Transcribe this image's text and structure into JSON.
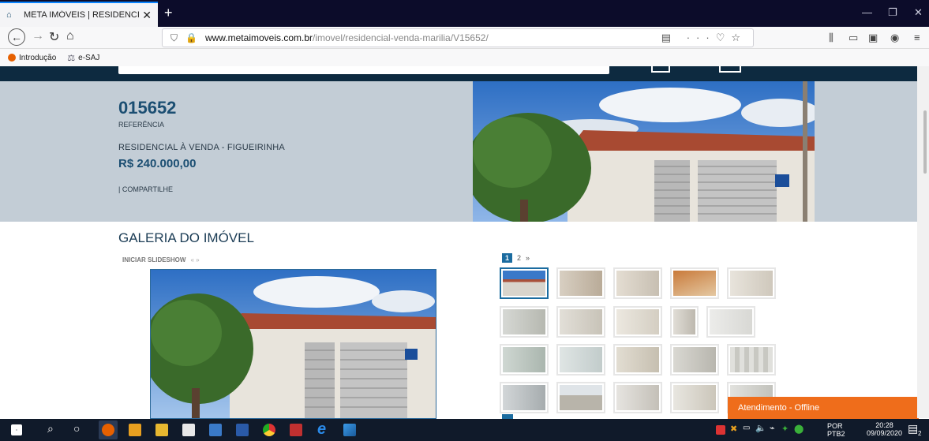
{
  "browser": {
    "tab_title": "META IMÓVEIS | RESIDENCIAL /",
    "tab_close": "✕",
    "new_tab": "+",
    "url_domain": "www.metaimoveis.com.br",
    "url_path": "/imovel/residencial-venda-marilia/V15652/",
    "bookmarks": [
      {
        "label": "Introdução"
      },
      {
        "label": "e-SAJ"
      }
    ]
  },
  "listing": {
    "reference": "015652",
    "reference_label": "REFERÊNCIA",
    "subtitle": "RESIDENCIAL À VENDA - FIGUEIRINHA",
    "price": "R$ 240.000,00",
    "share": "| COMPARTILHE"
  },
  "gallery": {
    "title": "GALERIA DO IMÓVEL",
    "slideshow_label": "INICIAR SLIDESHOW",
    "slideshow_arrows": "« »",
    "pages": [
      "1",
      "2"
    ],
    "next": "»"
  },
  "chat": {
    "label": "Atendimento - Offline"
  },
  "taskbar": {
    "lang_top": "POR",
    "lang_bottom": "PTB2",
    "time": "20:28",
    "date": "09/09/2020",
    "notif_count": "2"
  },
  "colors": {
    "brand_navy": "#0d2a40",
    "hero_bg": "#c3cdd6",
    "accent_blue": "#1b4e72",
    "chat_orange": "#ef6d1b"
  }
}
